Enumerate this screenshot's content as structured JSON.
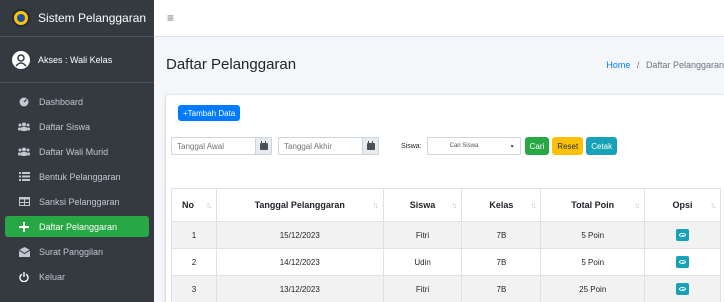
{
  "sidebar": {
    "brand": "Sistem Pelanggaran",
    "user": "Akses : Wali Kelas",
    "items": [
      {
        "label": "Dashboard",
        "icon": "dashboard-icon"
      },
      {
        "label": "Daftar Siswa",
        "icon": "users-icon"
      },
      {
        "label": "Daftar Wali Murid",
        "icon": "users-icon"
      },
      {
        "label": "Bentuk Pelanggaran",
        "icon": "list-icon"
      },
      {
        "label": "Sanksi Pelanggaran",
        "icon": "table-icon"
      },
      {
        "label": "Daftar Pelanggaran",
        "icon": "plus-icon",
        "active": true
      },
      {
        "label": "Surat Panggilan",
        "icon": "mail-icon"
      },
      {
        "label": "Keluar",
        "icon": "power-icon"
      }
    ]
  },
  "header": {
    "title": "Daftar Pelanggaran",
    "breadcrumb_home": "Home",
    "breadcrumb_sep": "/",
    "breadcrumb_current": "Daftar Pelanggaran"
  },
  "toolbar": {
    "add_label": "+Tambah Data"
  },
  "filters": {
    "start_placeholder": "Tanggal Awal",
    "end_placeholder": "Tanggal Akhir",
    "siswa_label": "Siswa:",
    "siswa_selected": "Cari Siswa",
    "search_label": "Cari",
    "reset_label": "Reset",
    "print_label": "Cetak"
  },
  "table": {
    "columns": [
      "No",
      "Tanggal Pelanggaran",
      "Siswa",
      "Kelas",
      "Total Poin",
      "Opsi"
    ],
    "rows": [
      [
        "1",
        "15/12/2023",
        "Fitri",
        "7B",
        "5 Poin"
      ],
      [
        "2",
        "14/12/2023",
        "Udin",
        "7B",
        "5 Poin"
      ],
      [
        "3",
        "13/12/2023",
        "Fitri",
        "7B",
        "25 Poin"
      ]
    ]
  },
  "colors": {
    "sidebar_bg": "#343a40",
    "active": "#28a745",
    "primary": "#007bff",
    "warning": "#ffc107",
    "info": "#17a2b8"
  }
}
